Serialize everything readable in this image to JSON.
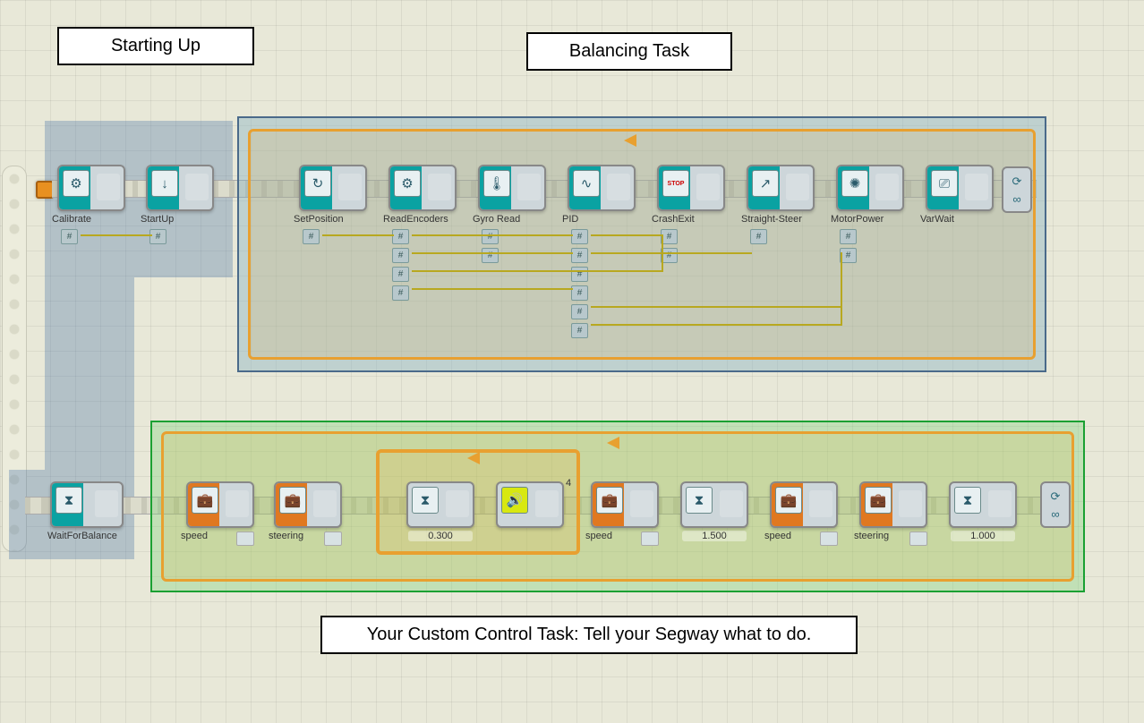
{
  "labels": {
    "starting_up": "Starting Up",
    "balancing_task": "Balancing Task",
    "custom_task": "Your Custom Control Task: Tell your Segway what to do."
  },
  "starting": {
    "calibrate": "Calibrate",
    "startup": "StartUp"
  },
  "balancing": {
    "set_position": "SetPosition",
    "read_encoders": "ReadEncoders",
    "gyro_read": "Gyro Read",
    "pid": "PID",
    "crash_exit": "CrashExit",
    "straight_steer": "Straight-Steer",
    "motor_power": "MotorPower",
    "var_wait": "VarWait"
  },
  "control_prelude": {
    "wait_for_balance": "WaitForBalance"
  },
  "control": {
    "speed1": "speed",
    "steering1": "steering",
    "wait1_value": "0.300",
    "sound_count": "4",
    "speed2": "speed",
    "wait2_value": "1.500",
    "speed3": "speed",
    "steering2": "steering",
    "wait3_value": "1.000"
  },
  "icons": {
    "calibrate": "⚙",
    "startup": "↓",
    "setpos": "↻",
    "encoders": "⚙",
    "gyro": "🌡",
    "pid": "∿",
    "stop": "STOP",
    "steer": "↗",
    "motor": "✺",
    "varwait": "⎚",
    "hourglass": "⧗",
    "suitcase": "💼",
    "timer": "⧗",
    "sound": "🔊",
    "loop": "∞",
    "cycle": "⟳"
  }
}
